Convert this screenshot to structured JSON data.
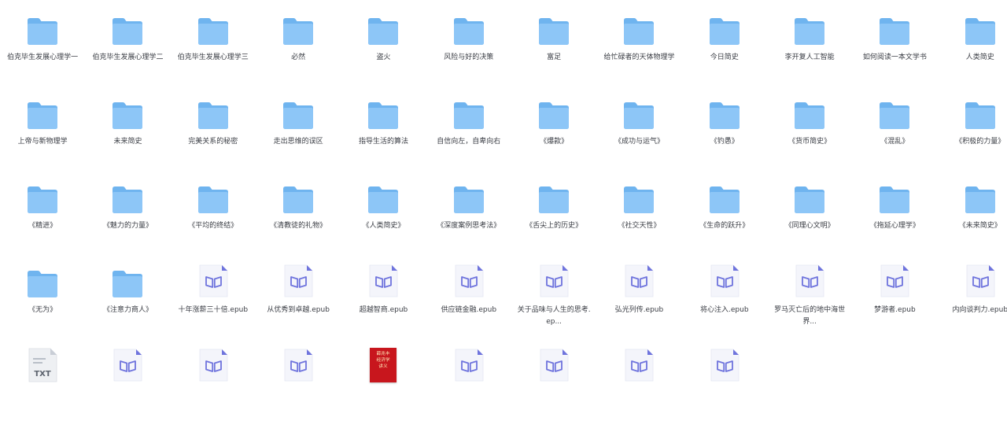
{
  "items": [
    {
      "type": "folder",
      "label": "伯克毕生发展心理学一"
    },
    {
      "type": "folder",
      "label": "伯克毕生发展心理学二"
    },
    {
      "type": "folder",
      "label": "伯克毕生发展心理学三"
    },
    {
      "type": "folder",
      "label": "必然"
    },
    {
      "type": "folder",
      "label": "盗火"
    },
    {
      "type": "folder",
      "label": "风险与好的决策"
    },
    {
      "type": "folder",
      "label": "富足"
    },
    {
      "type": "folder",
      "label": "给忙碌者的天体物理学"
    },
    {
      "type": "folder",
      "label": "今日简史"
    },
    {
      "type": "folder",
      "label": "李开复人工智能"
    },
    {
      "type": "folder",
      "label": "如何阅读一本文学书"
    },
    {
      "type": "folder",
      "label": "人类简史"
    },
    {
      "type": "folder",
      "label": "上帝与新物理学"
    },
    {
      "type": "folder",
      "label": "未来简史"
    },
    {
      "type": "folder",
      "label": "完美关系的秘密"
    },
    {
      "type": "folder",
      "label": "走出思维的误区"
    },
    {
      "type": "folder",
      "label": "指导生活的算法"
    },
    {
      "type": "folder",
      "label": "自信向左，自卑向右"
    },
    {
      "type": "folder",
      "label": "《爆款》"
    },
    {
      "type": "folder",
      "label": "《成功与运气》"
    },
    {
      "type": "folder",
      "label": "《钓愚》"
    },
    {
      "type": "folder",
      "label": "《货币简史》"
    },
    {
      "type": "folder",
      "label": "《混乱》"
    },
    {
      "type": "folder",
      "label": "《积极的力量》"
    },
    {
      "type": "folder",
      "label": "《精进》"
    },
    {
      "type": "folder",
      "label": "《魅力的力量》"
    },
    {
      "type": "folder",
      "label": "《平均的终结》"
    },
    {
      "type": "folder",
      "label": "《清教徒的礼物》"
    },
    {
      "type": "folder",
      "label": "《人类简史》"
    },
    {
      "type": "folder",
      "label": "《深度案例思考法》"
    },
    {
      "type": "folder",
      "label": "《舌尖上的历史》"
    },
    {
      "type": "folder",
      "label": "《社交天性》"
    },
    {
      "type": "folder",
      "label": "《生命的跃升》"
    },
    {
      "type": "folder",
      "label": "《同理心文明》"
    },
    {
      "type": "folder",
      "label": "《拖延心理学》"
    },
    {
      "type": "folder",
      "label": "《未来简史》"
    },
    {
      "type": "folder",
      "label": "《无为》"
    },
    {
      "type": "folder",
      "label": "《注意力商人》"
    },
    {
      "type": "epub",
      "label": "十年涨薪三十倍.epub"
    },
    {
      "type": "epub",
      "label": "从优秀到卓越.epub"
    },
    {
      "type": "epub",
      "label": "超越智商.epub"
    },
    {
      "type": "epub",
      "label": "供应链金融.epub"
    },
    {
      "type": "epub",
      "label": "关于品味与人生的思考.ep..."
    },
    {
      "type": "epub",
      "label": "弘光列传.epub"
    },
    {
      "type": "epub",
      "label": "将心注入.epub"
    },
    {
      "type": "epub",
      "label": "罗马灭亡后的地中海世界..."
    },
    {
      "type": "epub",
      "label": "梦游者.epub"
    },
    {
      "type": "epub",
      "label": "内向谈判力.epub"
    },
    {
      "type": "txt",
      "label": "",
      "icon_text": "TXT"
    },
    {
      "type": "epub",
      "label": ""
    },
    {
      "type": "epub",
      "label": ""
    },
    {
      "type": "epub",
      "label": ""
    },
    {
      "type": "book",
      "label": "",
      "cover_lines": [
        "薛兆丰",
        "经济学",
        "讲义"
      ]
    },
    {
      "type": "epub",
      "label": ""
    },
    {
      "type": "epub",
      "label": ""
    },
    {
      "type": "epub",
      "label": ""
    },
    {
      "type": "epub",
      "label": ""
    }
  ],
  "colors": {
    "folder_back": "#6fb4ef",
    "folder_front": "#8dc6f7",
    "epub_accent": "#6f74dd",
    "book_cover": "#c8161d"
  }
}
